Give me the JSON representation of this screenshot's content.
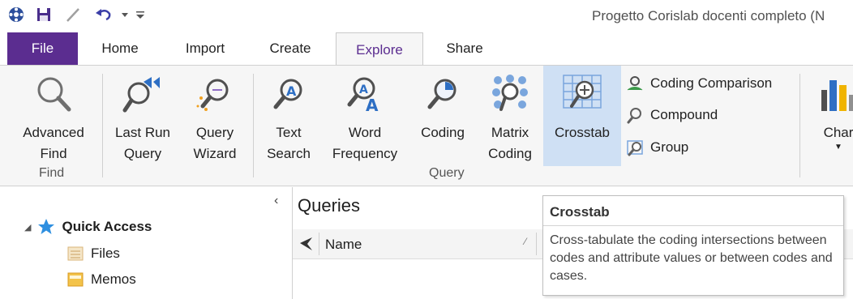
{
  "window": {
    "title": "Progetto Corislab docenti completo (N"
  },
  "tabs": [
    {
      "label": "File"
    },
    {
      "label": "Home"
    },
    {
      "label": "Import"
    },
    {
      "label": "Create"
    },
    {
      "label": "Explore"
    },
    {
      "label": "Share"
    }
  ],
  "ribbon": {
    "buttons": {
      "advanced_find": "Advanced\nFind",
      "last_run_query": "Last Run\nQuery",
      "query_wizard": "Query\nWizard",
      "text_search": "Text\nSearch",
      "word_frequency": "Word\nFrequency",
      "coding": "Coding",
      "matrix_coding": "Matrix\nCoding",
      "crosstab": "Crosstab",
      "charts": "Char"
    },
    "small_buttons": {
      "coding_comparison": "Coding Comparison",
      "compound": "Compound",
      "group": "Group"
    },
    "groups": {
      "find": "Find",
      "query": "Query"
    }
  },
  "nav": {
    "quick_access": "Quick Access",
    "files": "Files",
    "memos": "Memos"
  },
  "main": {
    "title": "Queries",
    "column_name": "Name"
  },
  "tooltip": {
    "title": "Crosstab",
    "body": "Cross-tabulate the coding intersections between codes and attribute values or between codes and cases."
  },
  "colors": {
    "file_tab": "#5b2d90",
    "selected_button": "#cfe0f4",
    "ribbon_bg": "#f6f6f6",
    "accent_blue": "#2e6fc4"
  }
}
